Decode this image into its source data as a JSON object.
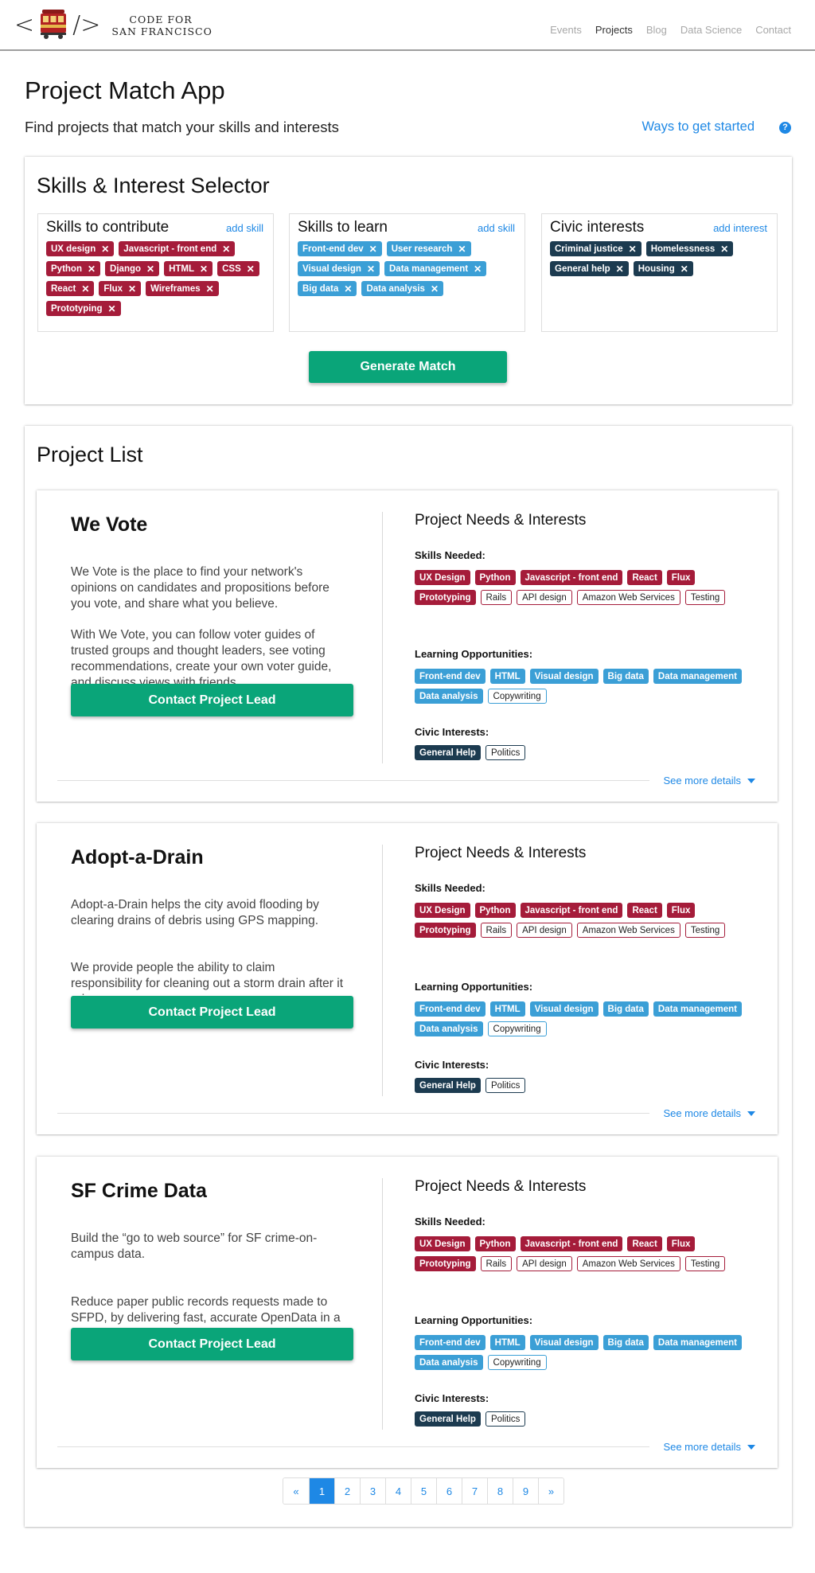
{
  "nav": {
    "logo_line1": "CODE FOR",
    "logo_line2": "SAN FRANCISCO",
    "links": [
      "Events",
      "Projects",
      "Blog",
      "Data Science",
      "Contact"
    ]
  },
  "header": {
    "title": "Project Match App",
    "subtitle": "Find projects that match your skills and interests",
    "get_started": "Ways to get started",
    "help": "?"
  },
  "selector": {
    "title": "Skills & Interest Selector",
    "contribute": {
      "title": "Skills to contribute",
      "add": "add skill",
      "tags": [
        "UX design",
        "Javascript - front end",
        "Python",
        "Django",
        "HTML",
        "CSS",
        "React",
        "Flux",
        "Wireframes",
        "Prototyping"
      ]
    },
    "learn": {
      "title": "Skills to learn",
      "add": "add skill",
      "tags": [
        "Front-end dev",
        "User research",
        "Visual design",
        "Data management",
        "Big data",
        "Data analysis"
      ]
    },
    "civic": {
      "title": "Civic interests",
      "add": "add interest",
      "tags": [
        "Criminal justice",
        "Homelessness",
        "General help",
        "Housing"
      ]
    },
    "remove_glyph": "✕",
    "generate": "Generate Match"
  },
  "project_list": {
    "title": "Project List",
    "needs_title": "Project Needs & Interests",
    "skills_label": "Skills Needed:",
    "learning_label": "Learning Opportunities:",
    "civic_label": "Civic Interests:",
    "contact_label": "Contact Project Lead",
    "see_more": "See more details",
    "projects": [
      {
        "name": "We Vote",
        "desc1": "We Vote is the place to find your network's opinions on candidates and propositions before you vote, and share what you believe.",
        "desc2": "With We Vote, you can follow voter guides of trusted groups and thought leaders, see voting recommendations, create your own voter guide, and discuss views with friends."
      },
      {
        "name": "Adopt-a-Drain",
        "desc1": "Adopt-a-Drain helps the city avoid flooding by clearing drains of debris using GPS mapping.",
        "desc2": "We provide people the ability to claim responsibility for cleaning out a storm drain after it rains."
      },
      {
        "name": "SF Crime Data",
        "desc1": "Build the “go to web source” for SF crime-on-campus data.",
        "desc2": "Reduce paper public records requests made to SFPD, by delivering fast, accurate OpenData in a web browser."
      }
    ],
    "skills_matched": [
      "UX Design",
      "Python",
      "Javascript - front end",
      "React",
      "Flux",
      "Prototyping"
    ],
    "skills_other": [
      "Rails",
      "API design",
      "Amazon Web Services",
      "Testing"
    ],
    "learning_matched": [
      "Front-end dev",
      "HTML",
      "Visual design",
      "Big data",
      "Data management",
      "Data analysis"
    ],
    "learning_other": [
      "Copywriting"
    ],
    "civic_matched": [
      "General Help"
    ],
    "civic_other": [
      "Politics"
    ]
  },
  "pagination": {
    "prev": "«",
    "pages": [
      "1",
      "2",
      "3",
      "4",
      "5",
      "6",
      "7",
      "8",
      "9"
    ],
    "next": "»",
    "current": "1"
  },
  "colors": {
    "skill": "#a51c3a",
    "learn": "#3b9fd6",
    "civic": "#1c3b50",
    "action": "#0aa579",
    "link": "#1e88e5"
  }
}
